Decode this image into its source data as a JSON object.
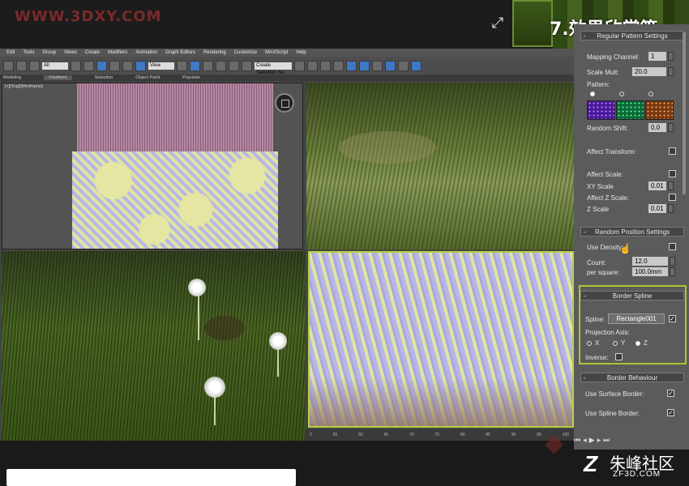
{
  "watermark_top": "WWW.3DXY.COM",
  "section_title": "7.效果欣赏篇",
  "menu": [
    "Edit",
    "Tools",
    "Group",
    "Views",
    "Create",
    "Modifiers",
    "Animation",
    "Graph Editors",
    "Rendering",
    "Customize",
    "MAXScript",
    "Help"
  ],
  "toolbar": {
    "filter_select": "All",
    "view_select": "View",
    "named_selection": "Create Selection Se"
  },
  "ribbon": [
    "Modeling",
    "Freeform",
    "Selection",
    "Object Paint",
    "Populate"
  ],
  "viewport_tl_label": "[+][Top][Wireframe]",
  "timeline_ticks": [
    "0",
    "55",
    "60",
    "65",
    "70",
    "75",
    "80",
    "85",
    "90",
    "95",
    "100"
  ],
  "panel": {
    "regular_pattern_header": "Regular Pattern Settings",
    "mapping_channel_label": "Mapping Channel:",
    "mapping_channel_value": "1",
    "scale_mult_label": "Scale Mult:",
    "scale_mult_value": "20.0",
    "pattern_label": "Pattern:",
    "random_shift_label": "Random Shift:",
    "random_shift_value": "0.0",
    "affect_transform_label": "Affect Transform:",
    "affect_scale_label": "Affect Scale:",
    "xy_scale_label": "XY Scale",
    "xy_scale_value": "0.01",
    "affect_z_scale_label": "Affect Z Scale:",
    "z_scale_label": "Z Scale",
    "z_scale_value": "0.01",
    "random_position_header": "Random Position Settings",
    "use_density_label": "Use Density:",
    "count_label": "Count:",
    "count_value": "12.0",
    "per_square_label": "per square:",
    "per_square_value": "100.0mm",
    "border_spline_header": "Border Spline",
    "spline_label": "Spline:",
    "spline_button": "Rectangle001",
    "projection_axis_label": "Projection Axis:",
    "axis_x": "X",
    "axis_y": "Y",
    "axis_z": "Z",
    "inverse_label": "Inverse:",
    "border_behaviour_header": "Border Behaviour",
    "use_surface_border_label": "Use Surface Border:",
    "use_spline_border_label": "Use Spline Border:"
  },
  "logo": {
    "mark": "Z",
    "cn": "朱峰社区",
    "en": "ZF3D.COM"
  }
}
